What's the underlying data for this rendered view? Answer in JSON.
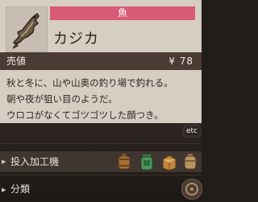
{
  "item": {
    "category": "魚",
    "name": "カジカ",
    "price_label": "売値",
    "price_value": "¥ 78",
    "description": [
      "秋と冬に、山や山奥の釣り場で釣れる。",
      "朝や夜が狙い目のようだ。",
      "ウロコがなくてゴツゴツした顔つき。"
    ],
    "icon": "fish-icon"
  },
  "ui": {
    "etc_label": "etc",
    "machines_label": "投入加工機",
    "category_label": "分類",
    "machine_icons": [
      "keg-icon",
      "preserves-jar-icon",
      "barrel-icon",
      "oil-maker-icon"
    ],
    "accent_color": "#d85a77"
  }
}
